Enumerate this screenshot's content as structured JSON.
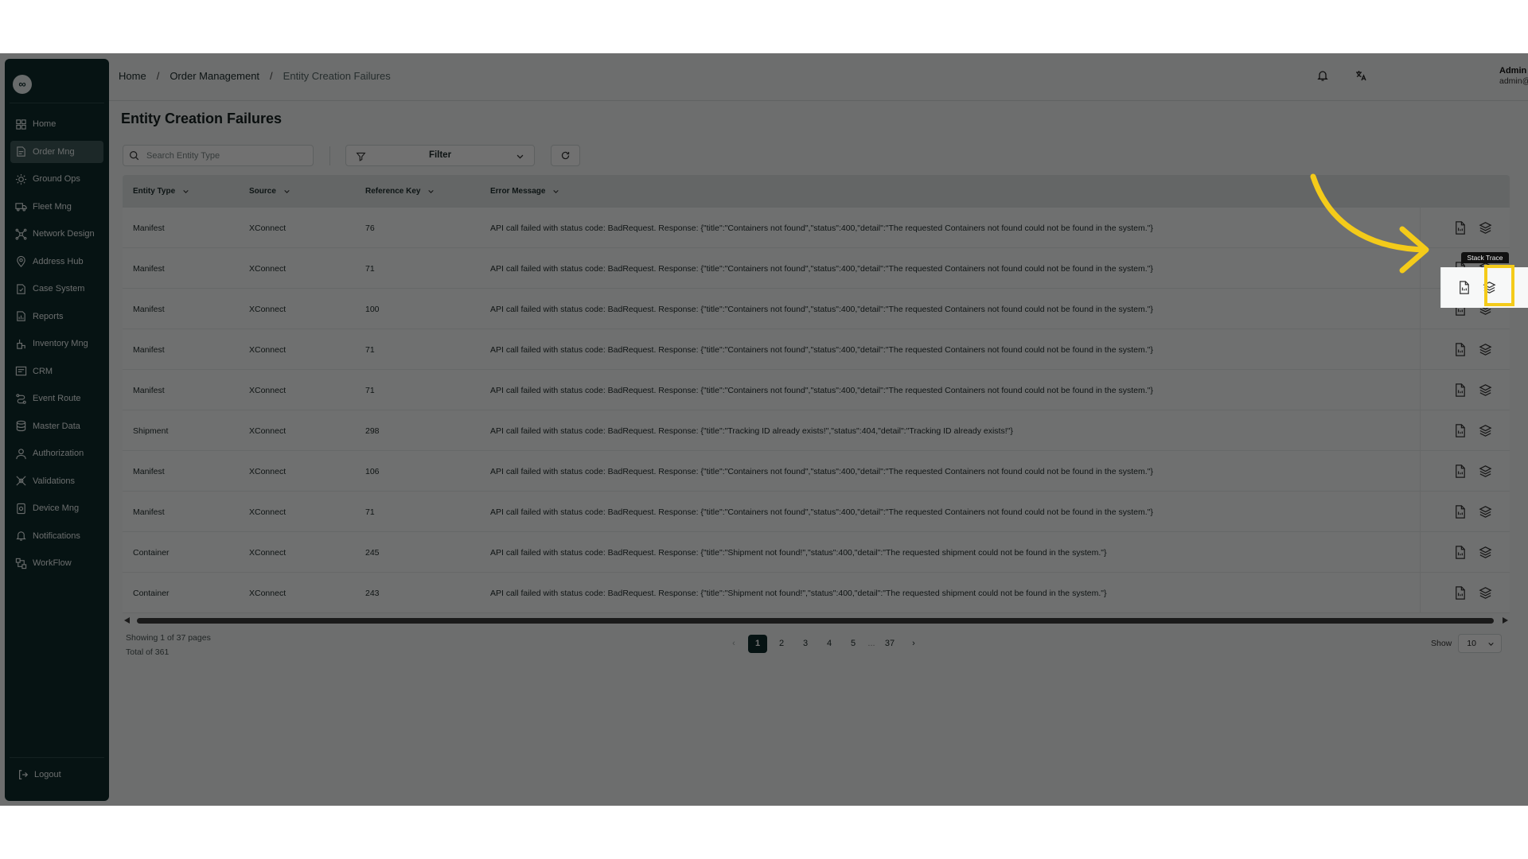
{
  "brand": {
    "logo_glyph": "∞"
  },
  "sidebar": {
    "items": [
      {
        "label": "Home",
        "icon": "grid-icon"
      },
      {
        "label": "Order Mng",
        "icon": "order-icon",
        "active": true
      },
      {
        "label": "Ground Ops",
        "icon": "sun-icon"
      },
      {
        "label": "Fleet Mng",
        "icon": "truck-icon"
      },
      {
        "label": "Network Design",
        "icon": "network-icon"
      },
      {
        "label": "Address Hub",
        "icon": "pin-icon"
      },
      {
        "label": "Case System",
        "icon": "case-icon"
      },
      {
        "label": "Reports",
        "icon": "report-icon"
      },
      {
        "label": "Inventory Mng",
        "icon": "inventory-icon"
      },
      {
        "label": "CRM",
        "icon": "crm-icon"
      },
      {
        "label": "Event Route",
        "icon": "route-icon"
      },
      {
        "label": "Master Data",
        "icon": "database-icon"
      },
      {
        "label": "Authorization",
        "icon": "user-icon"
      },
      {
        "label": "Validations",
        "icon": "validation-icon"
      },
      {
        "label": "Device Mng",
        "icon": "device-icon"
      },
      {
        "label": "Notifications",
        "icon": "bell-icon"
      },
      {
        "label": "WorkFlow",
        "icon": "workflow-icon"
      }
    ],
    "logout_label": "Logout"
  },
  "header": {
    "breadcrumb": [
      "Home",
      "Order Management",
      "Entity Creation Failures"
    ],
    "user": {
      "name": "Admin",
      "email": "admin@gnteq.com"
    }
  },
  "page": {
    "title": "Entity Creation Failures",
    "search_placeholder": "Search Entity Type",
    "filter_label": "Filter"
  },
  "table": {
    "columns": [
      "Entity Type",
      "Source",
      "Reference Key",
      "Error Message"
    ],
    "rows": [
      {
        "entity_type": "Manifest",
        "source": "XConnect",
        "reference_key": "76",
        "error": "API call failed with status code: BadRequest. Response: {\"title\":\"Containers not found\",\"status\":400,\"detail\":\"The requested Containers not found could not be found in the system.\"}"
      },
      {
        "entity_type": "Manifest",
        "source": "XConnect",
        "reference_key": "71",
        "error": "API call failed with status code: BadRequest. Response: {\"title\":\"Containers not found\",\"status\":400,\"detail\":\"The requested Containers not found could not be found in the system.\"}"
      },
      {
        "entity_type": "Manifest",
        "source": "XConnect",
        "reference_key": "100",
        "error": "API call failed with status code: BadRequest. Response: {\"title\":\"Containers not found\",\"status\":400,\"detail\":\"The requested Containers not found could not be found in the system.\"}"
      },
      {
        "entity_type": "Manifest",
        "source": "XConnect",
        "reference_key": "71",
        "error": "API call failed with status code: BadRequest. Response: {\"title\":\"Containers not found\",\"status\":400,\"detail\":\"The requested Containers not found could not be found in the system.\"}"
      },
      {
        "entity_type": "Manifest",
        "source": "XConnect",
        "reference_key": "71",
        "error": "API call failed with status code: BadRequest. Response: {\"title\":\"Containers not found\",\"status\":400,\"detail\":\"The requested Containers not found could not be found in the system.\"}"
      },
      {
        "entity_type": "Shipment",
        "source": "XConnect",
        "reference_key": "298",
        "error": "API call failed with status code: BadRequest. Response: {\"title\":\"Tracking ID already exists!\",\"status\":404,\"detail\":\"Tracking ID already exists!\"}"
      },
      {
        "entity_type": "Manifest",
        "source": "XConnect",
        "reference_key": "106",
        "error": "API call failed with status code: BadRequest. Response: {\"title\":\"Containers not found\",\"status\":400,\"detail\":\"The requested Containers not found could not be found in the system.\"}"
      },
      {
        "entity_type": "Manifest",
        "source": "XConnect",
        "reference_key": "71",
        "error": "API call failed with status code: BadRequest. Response: {\"title\":\"Containers not found\",\"status\":400,\"detail\":\"The requested Containers not found could not be found in the system.\"}"
      },
      {
        "entity_type": "Container",
        "source": "XConnect",
        "reference_key": "245",
        "error": "API call failed with status code: BadRequest. Response: {\"title\":\"Shipment not found!\",\"status\":400,\"detail\":\"The requested shipment could not be found in the system.\"}"
      },
      {
        "entity_type": "Container",
        "source": "XConnect",
        "reference_key": "243",
        "error": "API call failed with status code: BadRequest. Response: {\"title\":\"Shipment not found!\",\"status\":400,\"detail\":\"The requested shipment could not be found in the system.\"}"
      }
    ],
    "row_action_icons": [
      "document-icon",
      "stack-trace-icon"
    ],
    "tooltip": "Stack Trace"
  },
  "pagination": {
    "showing": "Showing 1 of 37 pages",
    "total": "Total of 361",
    "pages": [
      "1",
      "2",
      "3",
      "4",
      "5",
      "...",
      "37"
    ],
    "current": "1",
    "show_label": "Show",
    "page_size": "10"
  },
  "colors": {
    "sidebar_bg": "#0f2b2b",
    "highlight": "#f4cb1a",
    "overlay": "rgba(0,0,0,0.55)"
  }
}
